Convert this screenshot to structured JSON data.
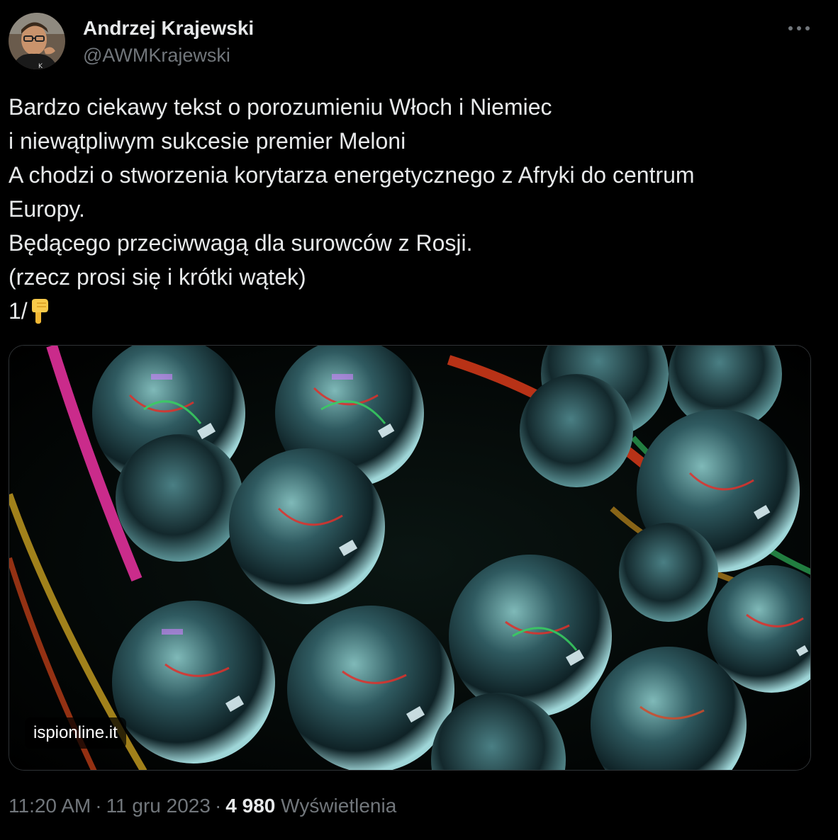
{
  "author": {
    "name": "Andrzej Krajewski",
    "handle": "@AWMKrajewski"
  },
  "tweet": {
    "lines": [
      "Bardzo ciekawy tekst o porozumieniu Włoch i Niemiec",
      "i niewątpliwym sukcesie premier Meloni",
      "A chodzi o stworzenia korytarza energetycznego z Afryki do centrum",
      "Europy.",
      "Będącego przeciwwagą dla surowców z Rosji.",
      "(rzecz prosi się i krótki wątek)",
      "1/"
    ],
    "emoji": "point-down-emoji"
  },
  "media": {
    "source_label": "ispionline.it"
  },
  "meta": {
    "time": "11:20 AM",
    "separator": "·",
    "date": "11 gru 2023",
    "views_count": "4 980",
    "views_label": "Wyświetlenia"
  },
  "colors": {
    "background": "#000000",
    "text": "#e7e9ea",
    "secondary_text": "#71767b",
    "border": "#2f3336"
  }
}
